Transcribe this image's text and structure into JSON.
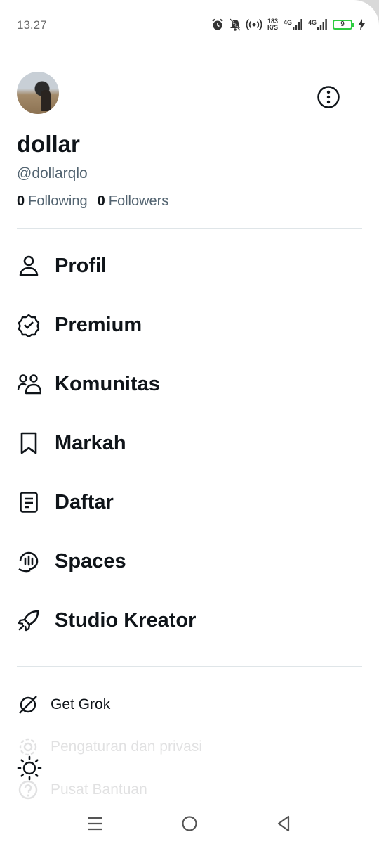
{
  "status_bar": {
    "time": "13.27",
    "net_speed_value": "183",
    "net_speed_unit": "K/S",
    "network_1": "4G",
    "network_2": "4G",
    "battery_level": "9"
  },
  "profile": {
    "display_name": "dollar",
    "handle": "@dollarqlo",
    "following_count": "0",
    "following_label": "Following",
    "followers_count": "0",
    "followers_label": "Followers"
  },
  "menu": {
    "items": [
      {
        "label": "Profil",
        "icon": "person-icon"
      },
      {
        "label": "Premium",
        "icon": "verified-badge-icon"
      },
      {
        "label": "Komunitas",
        "icon": "communities-icon"
      },
      {
        "label": "Markah",
        "icon": "bookmark-icon"
      },
      {
        "label": "Daftar",
        "icon": "list-icon"
      },
      {
        "label": "Spaces",
        "icon": "spaces-icon"
      },
      {
        "label": "Studio Kreator",
        "icon": "rocket-icon"
      }
    ]
  },
  "secondary": {
    "get_grok": "Get Grok",
    "settings": "Pengaturan dan privasi",
    "help": "Pusat Bantuan"
  },
  "colors": {
    "text_primary": "#0f1419",
    "text_secondary": "#536471",
    "divider": "#dfe5e8",
    "battery": "#2ecc40"
  }
}
